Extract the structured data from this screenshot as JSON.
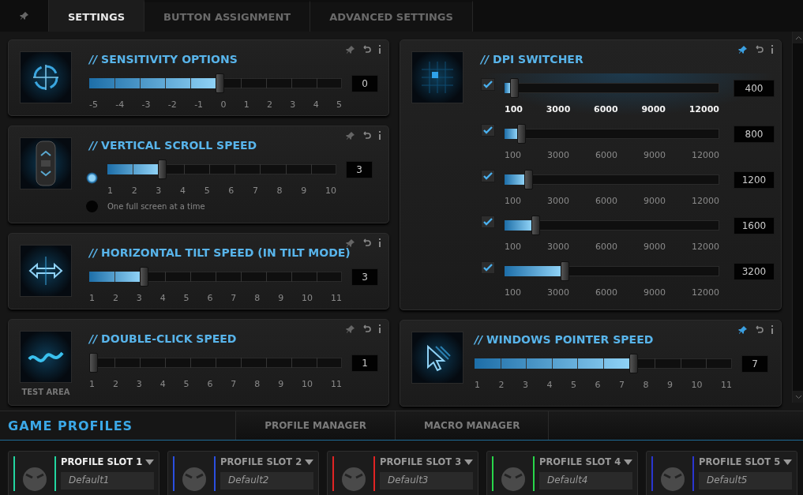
{
  "tabs": [
    {
      "label": "SETTINGS",
      "selected": true
    },
    {
      "label": "BUTTON ASSIGNMENT",
      "selected": false
    },
    {
      "label": "ADVANCED SETTINGS",
      "selected": false
    }
  ],
  "left_cards": [
    {
      "kind": "slider",
      "title": "*//* SENSITIVITY OPTIONS",
      "pinned": false,
      "slider": {
        "level": 0.5,
        "value": "0",
        "ticks": [
          "-5",
          "-4",
          "-3",
          "-2",
          "-1",
          "0",
          "1",
          "2",
          "3",
          "4",
          "5"
        ]
      }
    },
    {
      "kind": "scroll",
      "title": "*//* VERTICAL SCROLL SPEED",
      "pinned": false,
      "slider": {
        "level": 0.222,
        "value": "3",
        "ticks": [
          "1",
          "2",
          "3",
          "4",
          "5",
          "6",
          "7",
          "8",
          "9",
          "10"
        ]
      },
      "options": [
        {
          "selected": true
        },
        {
          "label": "One full screen at a time",
          "selected": false
        }
      ]
    },
    {
      "kind": "slider",
      "title": "*//* HORIZONTAL TILT SPEED (IN TILT MODE)",
      "pinned": false,
      "slider": {
        "level": 0.2,
        "value": "3",
        "ticks": [
          "1",
          "2",
          "3",
          "4",
          "5",
          "6",
          "7",
          "8",
          "9",
          "10",
          "11"
        ]
      }
    },
    {
      "kind": "slider",
      "title": "*//* DOUBLE-CLICK SPEED",
      "pinned": false,
      "caption": "TEST AREA",
      "slider": {
        "level": 0,
        "value": "1",
        "ticks": [
          "1",
          "2",
          "3",
          "4",
          "5",
          "6",
          "7",
          "8",
          "9",
          "10",
          "11"
        ]
      }
    }
  ],
  "dpi_switcher": {
    "title": "*//* DPI SWITCHER",
    "pinned": true,
    "rows": [
      {
        "checked": true,
        "selected": true,
        "level": 0.025,
        "value": "400",
        "ticks": [
          "100",
          "3000",
          "6000",
          "9000",
          "12000"
        ]
      },
      {
        "checked": true,
        "selected": false,
        "level": 0.059,
        "value": "800",
        "ticks": [
          "100",
          "3000",
          "6000",
          "9000",
          "12000"
        ]
      },
      {
        "checked": true,
        "selected": false,
        "level": 0.092,
        "value": "1200",
        "ticks": [
          "100",
          "3000",
          "6000",
          "9000",
          "12000"
        ]
      },
      {
        "checked": true,
        "selected": false,
        "level": 0.126,
        "value": "1600",
        "ticks": [
          "100",
          "3000",
          "6000",
          "9000",
          "12000"
        ]
      },
      {
        "checked": true,
        "selected": false,
        "level": 0.26,
        "value": "3200",
        "ticks": [
          "100",
          "3000",
          "6000",
          "9000",
          "12000"
        ]
      }
    ]
  },
  "pointer_card": {
    "title": "*//* WINDOWS POINTER SPEED",
    "pinned": true,
    "slider": {
      "level": 0.6,
      "value": "7",
      "ticks": [
        "1",
        "2",
        "3",
        "4",
        "5",
        "6",
        "7",
        "8",
        "9",
        "10",
        "11"
      ]
    }
  },
  "bottom_tabs": [
    {
      "label": "GAME PROFILES",
      "selected": true
    },
    {
      "label": "PROFILE MANAGER",
      "selected": false
    },
    {
      "label": "MACRO MANAGER",
      "selected": false
    }
  ],
  "profile_slots": [
    {
      "name": "PROFILE SLOT 1",
      "value": "Default1",
      "color": "#22d6a0",
      "selected": true
    },
    {
      "name": "PROFILE SLOT 2",
      "value": "Default2",
      "color": "#2a4fe0",
      "selected": false
    },
    {
      "name": "PROFILE SLOT 3",
      "value": "Default3",
      "color": "#e02424",
      "selected": false
    },
    {
      "name": "PROFILE SLOT 4",
      "value": "Default4",
      "color": "#28d64a",
      "selected": false
    },
    {
      "name": "PROFILE SLOT 5",
      "value": "Default5",
      "color": "#2a36d0",
      "selected": false
    }
  ]
}
